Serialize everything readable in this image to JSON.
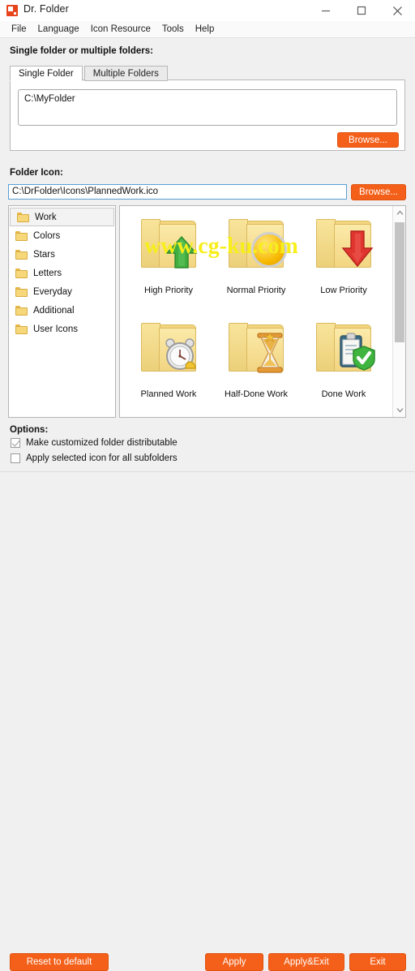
{
  "window": {
    "title": "Dr. Folder",
    "app_icon": "dr-folder-app-icon",
    "controls": {
      "minimize": "minimize-icon",
      "maximize": "maximize-icon",
      "close": "close-icon"
    }
  },
  "menu": {
    "items": [
      {
        "label": "File"
      },
      {
        "label": "Language"
      },
      {
        "label": "Icon Resource"
      },
      {
        "label": "Tools"
      },
      {
        "label": "Help"
      }
    ]
  },
  "folder_section": {
    "label": "Single folder or multiple folders:",
    "tabs": [
      {
        "label": "Single Folder",
        "active": true
      },
      {
        "label": "Multiple Folders",
        "active": false
      }
    ],
    "path_value": "C:\\MyFolder",
    "browse_label": "Browse..."
  },
  "icon_section": {
    "label": "Folder Icon:",
    "path_value": "C:\\DrFolder\\Icons\\PlannedWork.ico",
    "browse_label": "Browse...",
    "categories": [
      {
        "label": "Work",
        "selected": true
      },
      {
        "label": "Colors",
        "selected": false
      },
      {
        "label": "Stars",
        "selected": false
      },
      {
        "label": "Letters",
        "selected": false
      },
      {
        "label": "Everyday",
        "selected": false
      },
      {
        "label": "Additional",
        "selected": false
      },
      {
        "label": "User Icons",
        "selected": false
      }
    ],
    "icons": [
      {
        "label": "High Priority",
        "badge": "green-up-arrow-icon"
      },
      {
        "label": "Normal Priority",
        "badge": "yellow-circle-icon"
      },
      {
        "label": "Low Priority",
        "badge": "red-down-arrow-icon"
      },
      {
        "label": "Planned Work",
        "badge": "alarm-clock-icon"
      },
      {
        "label": "Half-Done Work",
        "badge": "hourglass-icon"
      },
      {
        "label": "Done Work",
        "badge": "clipboard-check-icon"
      }
    ],
    "scrollbar": {
      "up": "scroll-up-arrow-icon",
      "down": "scroll-down-arrow-icon"
    }
  },
  "options": {
    "label": "Options:",
    "items": [
      {
        "label": "Make customized folder distributable",
        "checked": true
      },
      {
        "label": "Apply selected icon for all subfolders",
        "checked": false
      }
    ]
  },
  "actions": {
    "reset": "Reset to default",
    "apply": "Apply",
    "apply_exit": "Apply&Exit",
    "exit": "Exit"
  },
  "watermark": {
    "text": "www.cg-ku.com",
    "color": "#f7ee1a"
  },
  "colors": {
    "accent_orange": "#f4601a",
    "window_bg": "#f0f0f0",
    "panel_bg": "#ffffff",
    "field_focus_border": "#5aa0d6"
  }
}
